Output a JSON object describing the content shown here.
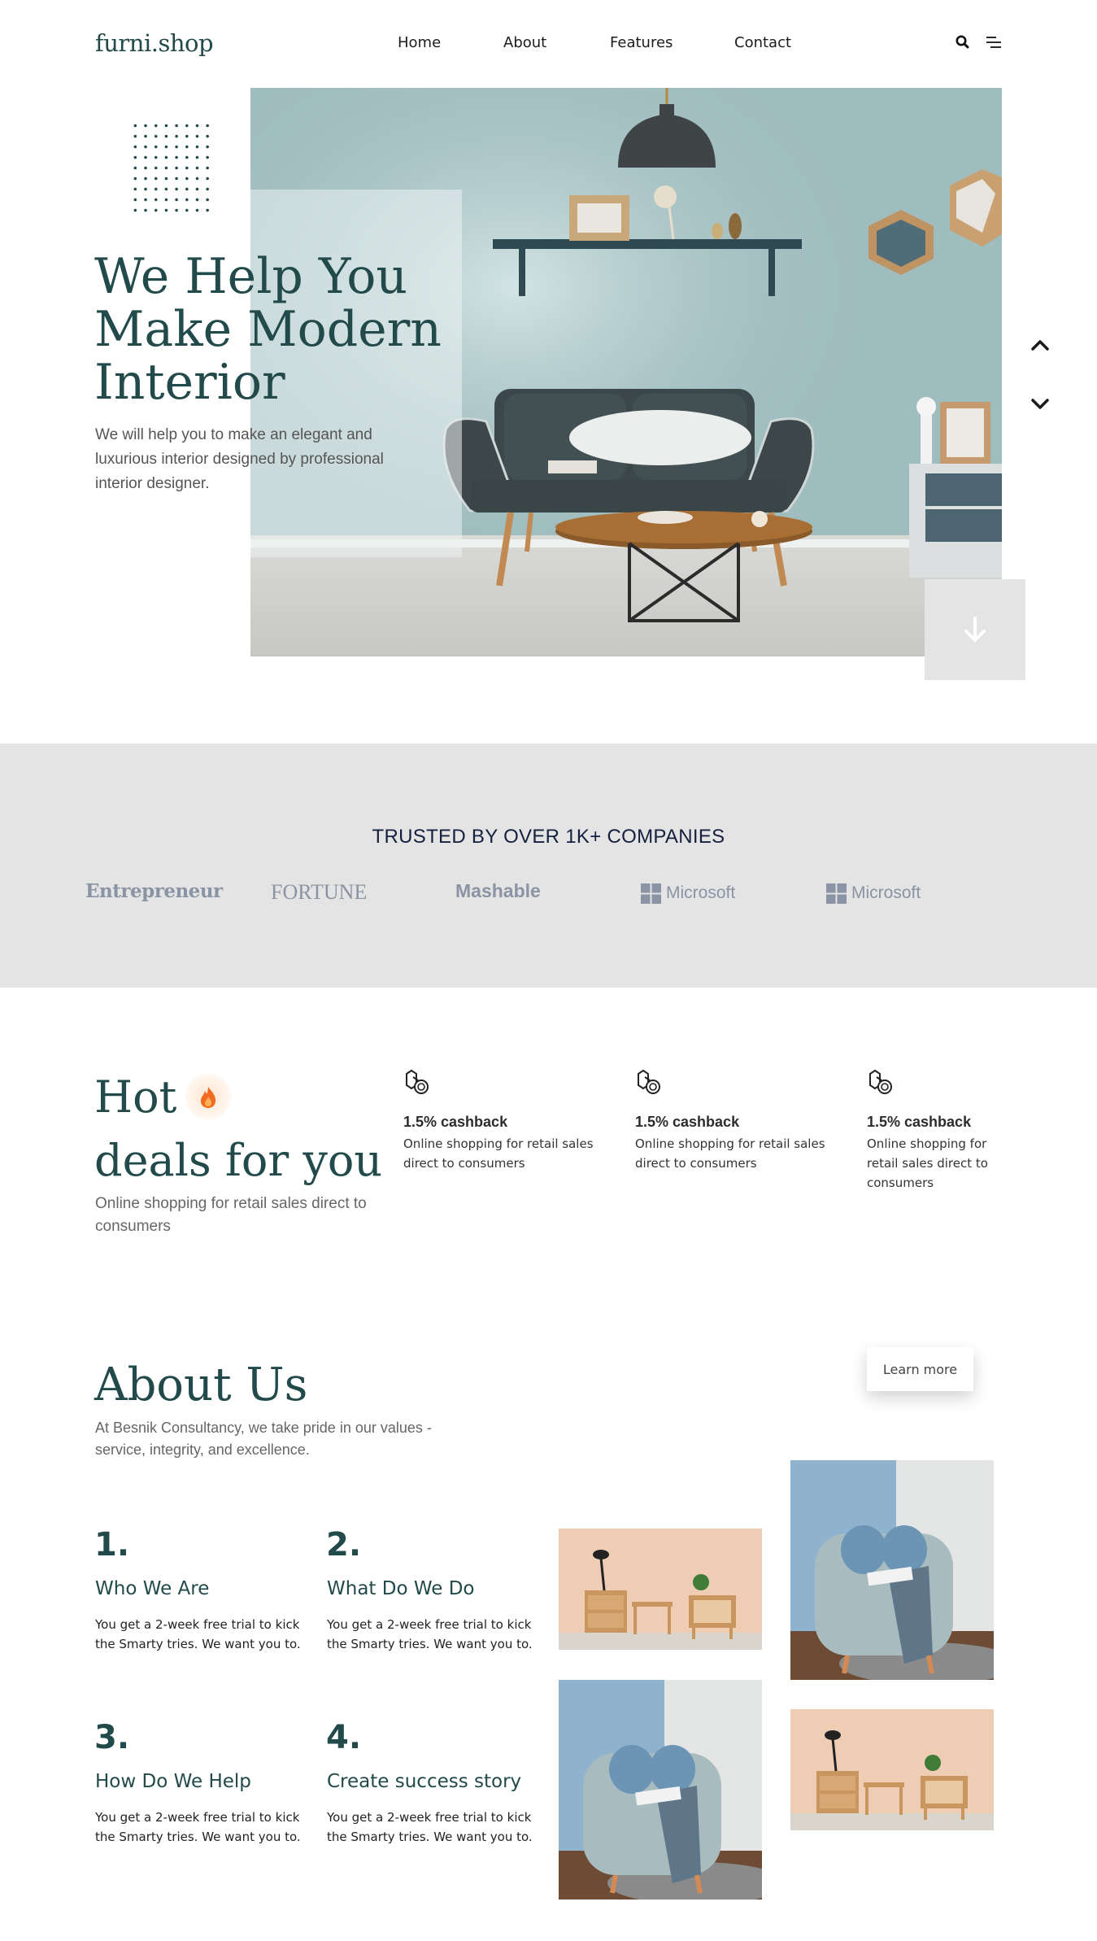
{
  "nav": {
    "logo": "furni.shop",
    "links": [
      "Home",
      "About",
      "Features",
      "Contact"
    ],
    "search_icon": "search-icon",
    "menu_icon": "menu-icon"
  },
  "hero": {
    "title_lines": [
      "We Help You",
      "Make Modern",
      "Interior"
    ],
    "subtitle": "We will help you to make an elegant and luxurious interior designed by professional interior designer.",
    "image": "living-room-sofa-photo"
  },
  "trusted": {
    "title": "TRUSTED BY OVER 1K+ COMPANIES",
    "brands": [
      "Entrepreneur",
      "FORTUNE",
      "Mashable",
      "Microsoft",
      "Microsoft"
    ]
  },
  "deals": {
    "title_line1": "Hot",
    "title_line2": "deals for you",
    "subtitle": "Online shopping for retail sales direct to consumers",
    "features": [
      {
        "title": "1.5% cashback",
        "text": "Online shopping for retail sales direct to consumers"
      },
      {
        "title": "1.5% cashback",
        "text": "Online shopping for retail sales direct to consumers"
      },
      {
        "title": "1.5% cashback",
        "text": "Online shopping for retail sales direct to consumers"
      }
    ]
  },
  "about": {
    "title": "About Us",
    "subtitle": "At Besnik Consultancy, we take pride in our values -service, integrity, and excellence.",
    "learn_more": "Learn more",
    "steps": [
      {
        "num": "1.",
        "title": "Who We Are",
        "text": "You get a 2-week free trial to kick the Smarty tries. We want you to."
      },
      {
        "num": "2.",
        "title": "What Do We Do",
        "text": "You get a 2-week free trial to kick the Smarty tries. We want you to."
      },
      {
        "num": "3.",
        "title": "How Do We Help",
        "text": "You get a 2-week free trial to kick the Smarty tries. We want you to."
      },
      {
        "num": "4.",
        "title": "Create success story",
        "text": "You get a 2-week free trial to kick the Smarty tries. We want you to."
      }
    ]
  },
  "colors": {
    "brand": "#224a4a",
    "wall": "#9fbcbe",
    "band": "#e4e4e4"
  }
}
